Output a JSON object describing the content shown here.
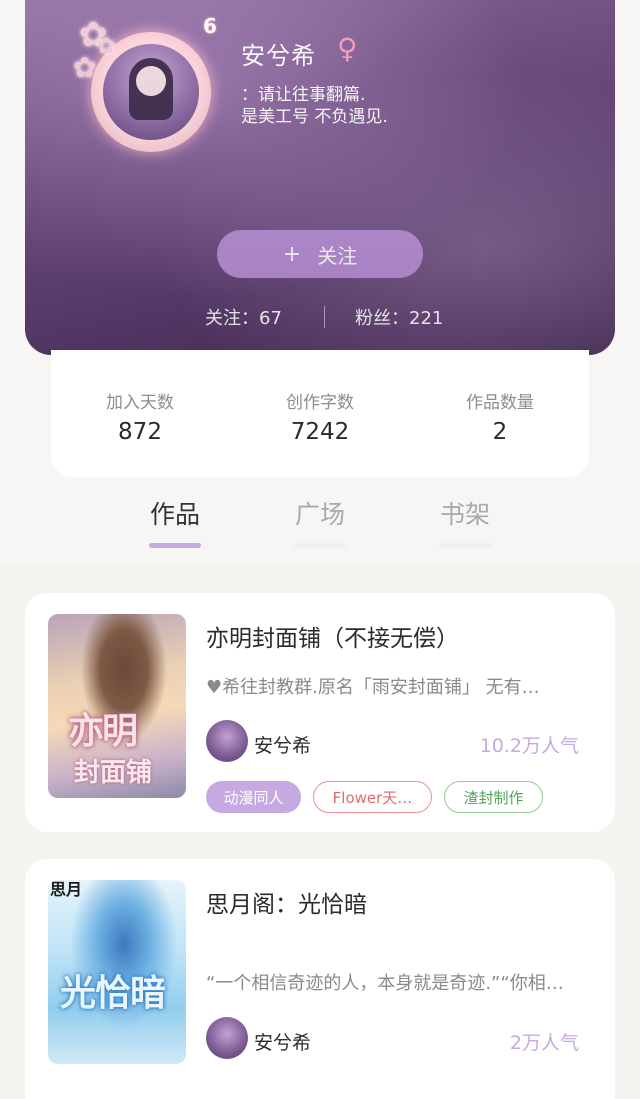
{
  "profile": {
    "level": "6",
    "name": "安兮希",
    "gender_symbol": "♀",
    "bio_line1": "：请让往事翻篇.",
    "bio_line2": "是美工号 不负遇见.",
    "follow_button": "关注",
    "follow_plus": "+",
    "following": "关注：67",
    "fans": "粉丝：221"
  },
  "stats": [
    {
      "label": "加入天数",
      "value": "872"
    },
    {
      "label": "创作字数",
      "value": "7242"
    },
    {
      "label": "作品数量",
      "value": "2"
    }
  ],
  "tabs": [
    {
      "label": "作品",
      "active": true
    },
    {
      "label": "广场",
      "active": false
    },
    {
      "label": "书架",
      "active": false
    }
  ],
  "works": [
    {
      "title": "亦明封面铺（不接无偿）",
      "description": "♥希往封教群.原名「雨安封面铺」 无有…",
      "author": "安兮希",
      "popularity": "10.2万人气",
      "cover_text_1": "亦明",
      "cover_text_2": "封面铺",
      "tags": [
        "动漫同人",
        "Flower天…",
        "渣封制作"
      ]
    },
    {
      "title": "思月阁：光恰暗",
      "description": "“一个相信奇迹的人，本身就是奇迹.”“你相…",
      "author": "安兮希",
      "popularity": "2万人气",
      "cover_text_1": "光恰暗",
      "cover_text_2": "思月"
    }
  ],
  "colors": {
    "accent": "#c7a9e2",
    "button": "#b98fd8",
    "tag_red": "#ef8f8f",
    "tag_green": "#8fcf93"
  }
}
